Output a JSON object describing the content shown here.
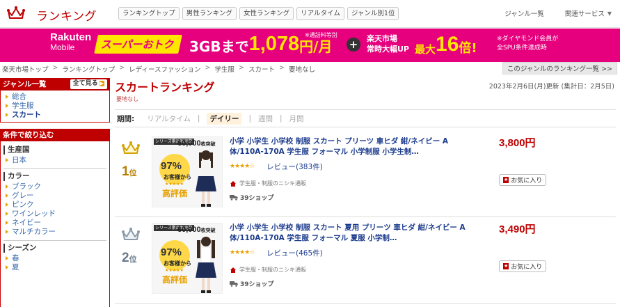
{
  "header": {
    "title": "ランキング",
    "tabs": [
      "ランキングトップ",
      "男性ランキング",
      "女性ランキング",
      "リアルタイム",
      "ジャンル別1位"
    ],
    "links": [
      "ジャンル一覧",
      "関連サービス"
    ]
  },
  "banner": {
    "brand": "Rakuten",
    "brand_sub": "Mobile",
    "promo": "スーパーおトク",
    "plan": "3GBまで",
    "price": "1,078",
    "price_unit": "円/月",
    "price_note": "※通話料等別",
    "ichiba_line1": "楽天市場",
    "ichiba_line2": "常時大幅UP",
    "max_prefix": "最大",
    "max_value": "16",
    "max_suffix": "倍!",
    "note_line1": "※ダイヤモンド会員が",
    "note_line2": "全SPU条件達成時"
  },
  "breadcrumb": [
    "楽天市場トップ",
    "ランキングトップ",
    "レディースファッション",
    "学生服",
    "スカート",
    "要地なし"
  ],
  "genre_list_button": "このジャンルのランキング一覧 >>",
  "sidebar": {
    "genre_heading": "ジャンル一覧",
    "show_all": "全て見る",
    "genres": [
      {
        "label": "総合"
      },
      {
        "label": "学生服"
      },
      {
        "label": "スカート"
      }
    ],
    "filter_heading": "条件で絞り込む",
    "production_heading": "生産国",
    "production": [
      "日本"
    ],
    "color_heading": "カラー",
    "colors": [
      "ブラック",
      "グレー",
      "ピンク",
      "ワインレッド",
      "ネイビー",
      "マルチカラー"
    ],
    "season_heading": "シーズン",
    "seasons": [
      "春",
      "夏"
    ]
  },
  "main": {
    "title": "スカートランキング",
    "subtitle": "要地なし",
    "updated": "2023年2月6日(月)更新 (集計日：2月5日)",
    "period_label": "期間:",
    "periods": [
      {
        "label": "リアルタイム",
        "active": false
      },
      {
        "label": "デイリー",
        "active": true
      },
      {
        "label": "週間",
        "active": false
      },
      {
        "label": "月間",
        "active": false
      }
    ]
  },
  "items": [
    {
      "rank": "1",
      "rank_suffix": "位",
      "name": "小学 小学生 小学校 制服 スカート プリーツ 車ヒダ 紺/ネイビー A体/110A-170A 学生服 フォーマル 小学制服 小学生制…",
      "stars": "★★★★☆",
      "review": "レビュー(383件)",
      "shop": "学生服・制服のニシキ通販",
      "shipping": "39ショップ",
      "price": "3,800円",
      "fav": "お気に入り",
      "thumb_badge": "シリーズ累計販売数",
      "thumb_count": "60,000",
      "thumb_count_unit": "枚突破",
      "thumb_pct": "97%",
      "thumb_text": "以上の",
      "thumb_text2": "お客様から",
      "thumb_stars": "★★★★★",
      "thumb_high": "高評価"
    },
    {
      "rank": "2",
      "rank_suffix": "位",
      "name": "小学 小学生 小学校 制服 スカート 夏用 プリーツ 車ヒダ 紺/ネイビー A体/110A-170A 学生服 フォーマル 夏服 小学制…",
      "stars": "★★★★☆",
      "review": "レビュー(465件)",
      "shop": "学生服・制服のニシキ通販",
      "shipping": "39ショップ",
      "price": "3,490円",
      "fav": "お気に入り",
      "thumb_badge": "シリーズ累計販売数",
      "thumb_count": "60,000",
      "thumb_count_unit": "枚突破",
      "thumb_pct": "97%",
      "thumb_text": "以上の",
      "thumb_text2": "お客様から",
      "thumb_stars": "★★★★★",
      "thumb_high": "高評価"
    }
  ],
  "colors": {
    "brand_red": "#bf0000",
    "banner_pink": "#e6007e",
    "banner_yellow": "#ffe600",
    "link_blue": "#1a3a8c",
    "star_gold": "#e8a000"
  }
}
